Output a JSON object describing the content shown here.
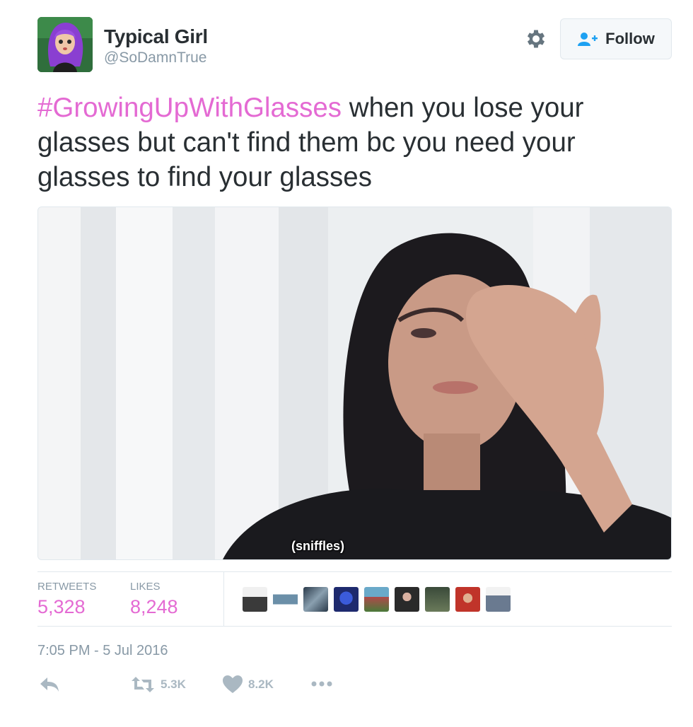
{
  "user": {
    "display_name": "Typical Girl",
    "handle": "@SoDamnTrue",
    "avatar_icon": "purple-hair-cartoon-avatar"
  },
  "header": {
    "follow_label": "Follow",
    "settings_icon": "gear-icon",
    "follow_icon": "add-user-icon"
  },
  "tweet": {
    "hashtag": "#GrowingUpWithGlasses",
    "text": " when you lose your glasses but can't find them bc you need your glasses to find your glasses"
  },
  "media": {
    "caption": "(sniffles)"
  },
  "stats": {
    "retweets_label": "RETWEETS",
    "retweets_value": "5,328",
    "likes_label": "LIKES",
    "likes_value": "8,248",
    "likers_count": 9
  },
  "timestamp": "7:05 PM - 5 Jul 2016",
  "actions": {
    "reply_icon": "reply-icon",
    "retweet_icon": "retweet-icon",
    "retweet_count": "5.3K",
    "like_icon": "heart-icon",
    "like_count": "8.2K",
    "more_icon": "more-dots-icon"
  },
  "colors": {
    "accent": "#e46ad3",
    "muted": "#8899a6",
    "text": "#292f33"
  }
}
